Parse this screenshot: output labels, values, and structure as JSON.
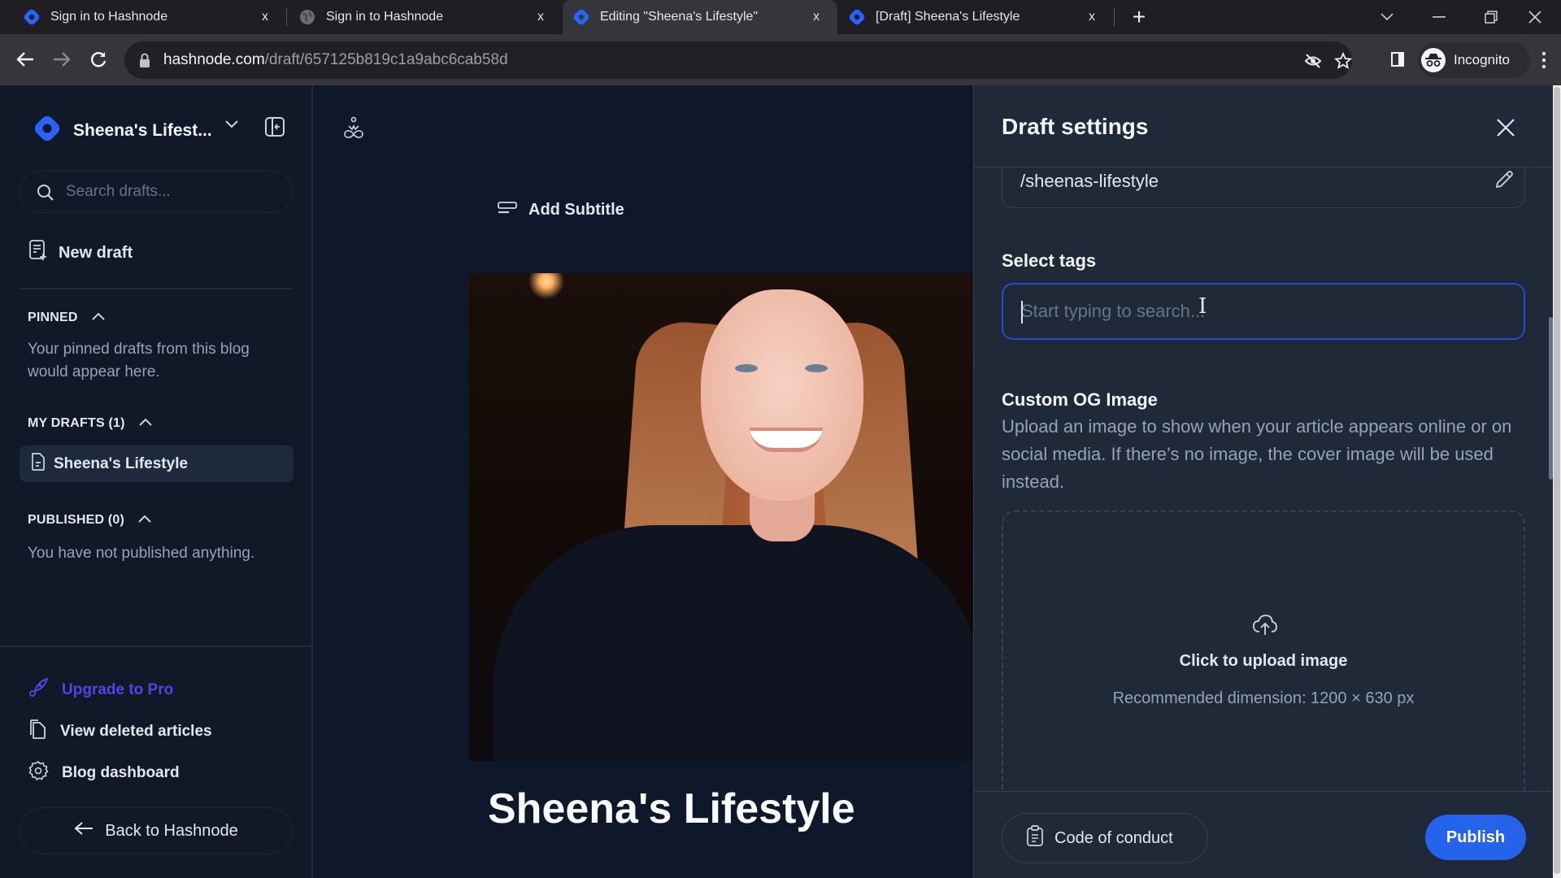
{
  "browser": {
    "tabs": [
      {
        "title": "Sign in to Hashnode",
        "favicon": "hashnode-logo-icon",
        "active": false
      },
      {
        "title": "Sign in to Hashnode",
        "favicon": "globe-icon",
        "active": false
      },
      {
        "title": "Editing \"Sheena's Lifestyle\"",
        "favicon": "hashnode-logo-icon",
        "active": true
      },
      {
        "title": "[Draft] Sheena's Lifestyle",
        "favicon": "hashnode-logo-icon",
        "active": false
      }
    ],
    "close_glyph": "x",
    "new_tab_glyph": "+",
    "url_host": "hashnode.com",
    "url_path": "/draft/657125b819c1a9abc6cab58d",
    "profile_label": "Incognito"
  },
  "sidebar": {
    "blog_name": "Sheena's Lifest...",
    "search_placeholder": "Search drafts...",
    "new_draft_label": "New draft",
    "pinned": {
      "heading": "PINNED",
      "empty_text": "Your pinned drafts from this blog would appear here."
    },
    "my_drafts": {
      "heading": "MY DRAFTS (1)",
      "items": [
        {
          "title": "Sheena's Lifestyle"
        }
      ]
    },
    "published": {
      "heading": "PUBLISHED (0)",
      "empty_text": "You have not published anything."
    },
    "links": {
      "upgrade": "Upgrade to Pro",
      "deleted": "View deleted articles",
      "dashboard": "Blog dashboard"
    },
    "back_label": "Back to Hashnode"
  },
  "editor": {
    "add_subtitle_label": "Add Subtitle",
    "article_title": "Sheena's Lifestyle"
  },
  "draft_settings": {
    "title": "Draft settings",
    "slug_value": "/sheenas-lifestyle",
    "tags_label": "Select tags",
    "tags_placeholder": "Start typing to search...",
    "og_label": "Custom OG Image",
    "og_description": "Upload an image to show when your article appears online or on social media. If there’s no image, the cover image will be used instead.",
    "upload_label": "Click to upload image",
    "upload_hint": "Recommended dimension: 1200 × 630 px",
    "code_of_conduct_label": "Code of conduct",
    "publish_label": "Publish"
  },
  "colors": {
    "accent": "#2563eb",
    "brand": "#2962ff",
    "upgrade": "#4f46e5",
    "panel_bg": "#1f2937",
    "sidebar_bg": "#111827"
  }
}
